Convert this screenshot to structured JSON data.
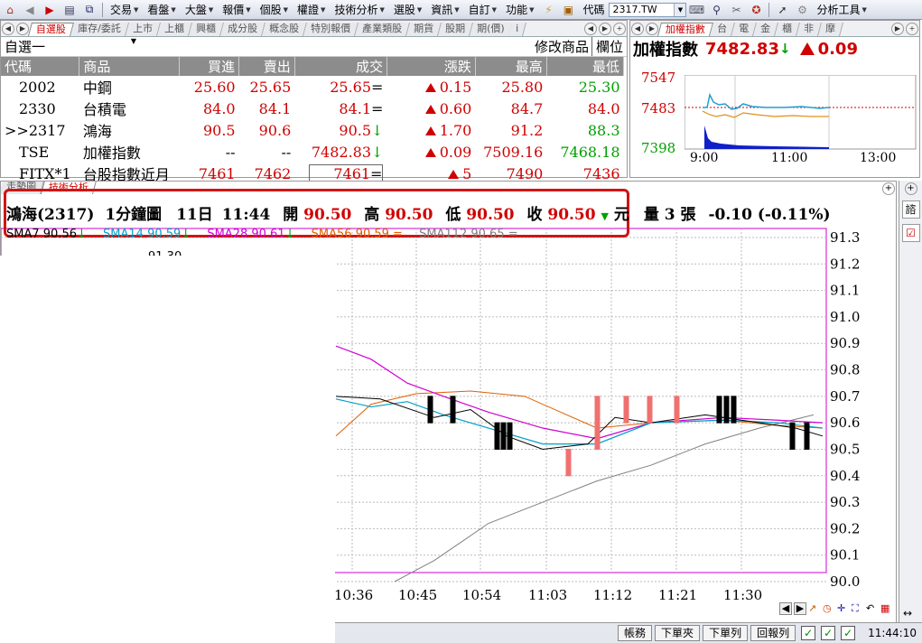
{
  "menubar": {
    "items": [
      {
        "label": "交易"
      },
      {
        "label": "看盤"
      },
      {
        "label": "大盤"
      },
      {
        "label": "報價"
      },
      {
        "label": "個股"
      },
      {
        "label": "權證"
      },
      {
        "label": "技術分析"
      },
      {
        "label": "選股"
      },
      {
        "label": "資訊"
      },
      {
        "label": "自訂"
      },
      {
        "label": "功能"
      }
    ],
    "code_label": "代碼",
    "code_value": "2317.TW",
    "analysis_tools": "分析工具"
  },
  "watch_tabs": [
    "自選股",
    "庫存/委託",
    "上市",
    "上櫃",
    "興櫃",
    "成分股",
    "概念股",
    "特別報價",
    "產業類股",
    "期貨",
    "股期",
    "期(價)",
    "i"
  ],
  "watch": {
    "group": "自選一",
    "modify_label": "修改商品",
    "column_label": "欄位",
    "headers": [
      "代碼",
      "商品",
      "買進",
      "賣出",
      "成交",
      "漲跌",
      "最高",
      "最低"
    ],
    "rows": [
      {
        "code": "2002",
        "name": "中鋼",
        "bid": "25.60",
        "ask": "25.65",
        "last": "25.65",
        "mark": "=",
        "chg": "0.15",
        "high": "25.80",
        "low": "25.30"
      },
      {
        "code": "2330",
        "name": "台積電",
        "bid": "84.0",
        "ask": "84.1",
        "last": "84.1",
        "mark": "=",
        "chg": "0.60",
        "high": "84.7",
        "low": "84.0"
      },
      {
        "code": ">>2317",
        "name": "鴻海",
        "bid": "90.5",
        "ask": "90.6",
        "last": "90.5",
        "mark": "↓",
        "chg": "1.70",
        "high": "91.2",
        "low": "88.3"
      },
      {
        "code": "TSE",
        "name": "加權指數",
        "bid": "--",
        "ask": "--",
        "last": "7482.83",
        "mark": "↓",
        "chg": "0.09",
        "high": "7509.16",
        "low": "7468.18"
      },
      {
        "code": "FITX*1",
        "name": "台股指數近月",
        "bid": "7461",
        "ask": "7462",
        "last": "7461",
        "mark": "=",
        "chg": "5",
        "high": "7490",
        "low": "7436"
      }
    ]
  },
  "index_tabs": [
    "加權指數",
    "台",
    "電",
    "金",
    "櫃",
    "非",
    "摩"
  ],
  "index": {
    "title": "加權指數",
    "value": "7482.83",
    "change": "0.09",
    "y_labels": [
      "7547",
      "7483",
      "7398"
    ],
    "x_labels": [
      "9:00",
      "11:00",
      "13:00"
    ]
  },
  "lower_tabs": [
    "走勢圖",
    "技術分析"
  ],
  "quote": {
    "name": "鴻海(2317)",
    "period": "1分鐘圖",
    "date": "11日",
    "time": "11:44",
    "open_label": "開",
    "open": "90.50",
    "high_label": "高",
    "high": "90.50",
    "low_label": "低",
    "low": "90.50",
    "close_label": "收",
    "close": "90.50",
    "unit": "元",
    "volume_label": "量",
    "volume": "3",
    "volume_unit": "張",
    "change": "-0.10 (-0.11%)"
  },
  "ma_legend": [
    {
      "text": "SMA7 90.56",
      "color": "#000000"
    },
    {
      "text": "SMA14 90.59",
      "color": "#00a0c8"
    },
    {
      "text": "SMA28 90.61",
      "color": "#d000d0"
    },
    {
      "text": "SMA56 90.59 =",
      "color": "#e06000"
    },
    {
      "text": "SMA112 90.65 =",
      "color": "#808080"
    }
  ],
  "partial_label": "91.30",
  "chart_data": {
    "type": "candlestick",
    "y_ticks": [
      "91.3",
      "91.2",
      "91.1",
      "91.0",
      "90.9",
      "90.8",
      "90.7",
      "90.6",
      "90.5",
      "90.4",
      "90.3",
      "90.2",
      "90.1",
      "90.0"
    ],
    "x_ticks": [
      "10:36",
      "10:45",
      "10:54",
      "11:03",
      "11:12",
      "11:21",
      "11:30"
    ],
    "ylim": [
      90.0,
      91.3
    ],
    "grid": true
  },
  "rightbar": {
    "label": "諮"
  },
  "status": {
    "buttons": [
      "帳務",
      "下單夾",
      "下單列",
      "回報列"
    ],
    "time": "11:44:10"
  },
  "colors": {
    "up": "#d00000",
    "down": "#00a000",
    "highlight": "#d01414"
  }
}
